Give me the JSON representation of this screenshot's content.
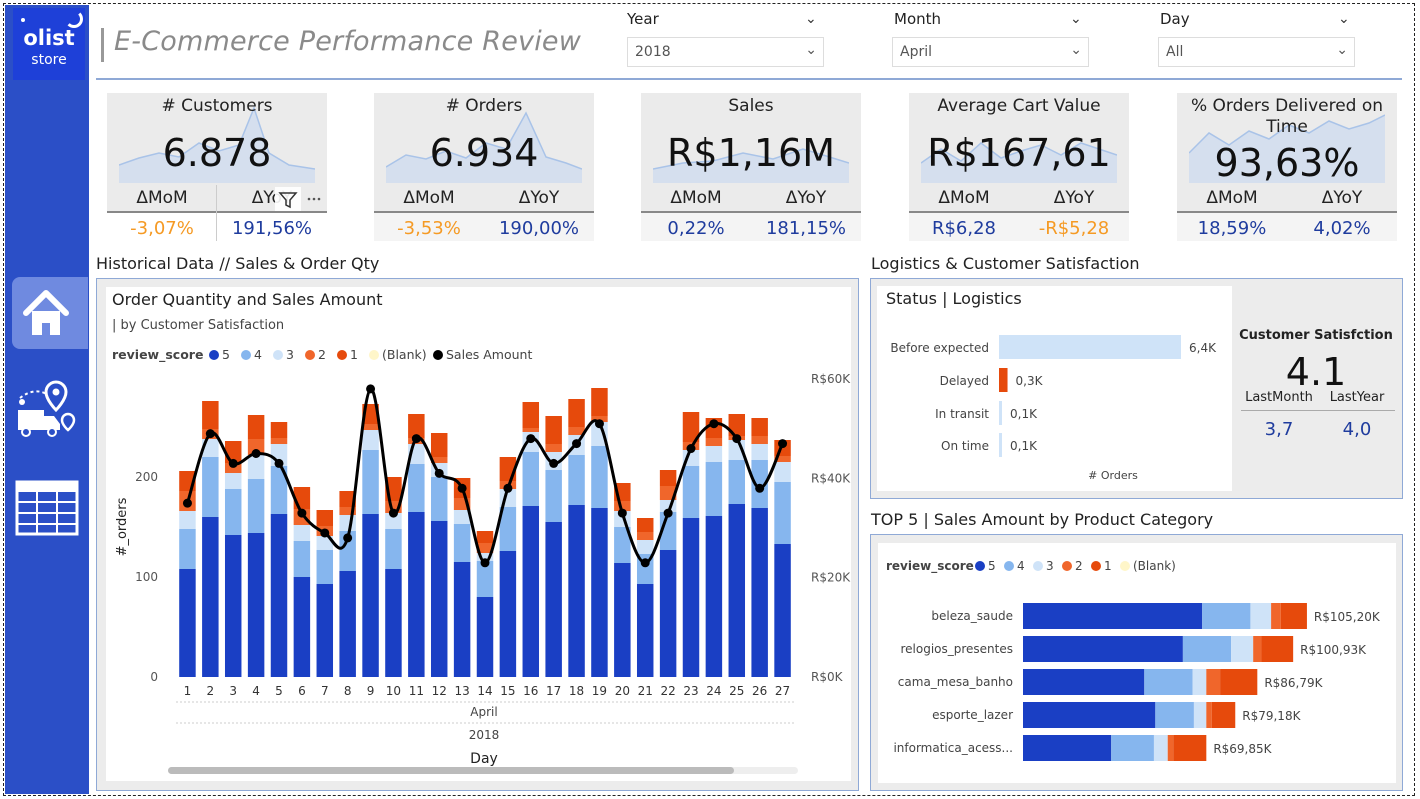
{
  "app": {
    "logo_line1": "olist",
    "logo_line2": "store",
    "title": "E-Commerce Performance Review"
  },
  "nav": [
    {
      "id": "home",
      "icon": "home-icon"
    },
    {
      "id": "logistics",
      "icon": "delivery-truck-icon"
    },
    {
      "id": "table",
      "icon": "table-grid-icon"
    }
  ],
  "filters": {
    "year": {
      "label": "Year",
      "value": "2018"
    },
    "month": {
      "label": "Month",
      "value": "April"
    },
    "day": {
      "label": "Day",
      "value": "All"
    }
  },
  "kpis": [
    {
      "title": "# Customers",
      "value": "6.878",
      "mom_label": "ΔMoM",
      "yoy_label": "ΔYoY",
      "mom": "-3,07%",
      "yoy": "191,56%",
      "mom_color": "#f59a24",
      "yoy_color": "#1f3c9e"
    },
    {
      "title": "# Orders",
      "value": "6.934",
      "mom_label": "ΔMoM",
      "yoy_label": "ΔYoY",
      "mom": "-3,53%",
      "yoy": "190,00%",
      "mom_color": "#f59a24",
      "yoy_color": "#1f3c9e"
    },
    {
      "title": "Sales",
      "value": "R$1,16M",
      "mom_label": "ΔMoM",
      "yoy_label": "ΔYoY",
      "mom": "0,22%",
      "yoy": "181,15%",
      "mom_color": "#1f3c9e",
      "yoy_color": "#1f3c9e"
    },
    {
      "title": "Average Cart Value",
      "value": "R$167,61",
      "mom_label": "ΔMoM",
      "yoy_label": "ΔYoY",
      "mom": "R$6,28",
      "yoy": "-R$5,28",
      "mom_color": "#1f3c9e",
      "yoy_color": "#f59a24"
    },
    {
      "title": "% Orders Delivered on Time",
      "value": "93,63%",
      "mom_label": "ΔMoM",
      "yoy_label": "ΔYoY",
      "mom": "18,59%",
      "yoy": "4,02%",
      "mom_color": "#1f3c9e",
      "yoy_color": "#1f3c9e"
    }
  ],
  "sections": {
    "historical": "Historical Data // Sales & Order Qty",
    "logistics": "Logistics & Customer Satisfaction",
    "top5": "TOP 5 | Sales Amount by Product Category"
  },
  "chart_data": [
    {
      "type": "bar",
      "title": "Order Quantity and Sales Amount",
      "subtitle": "| by Customer Satisfaction",
      "legend_title": "review_score",
      "legend_placement": "top-left",
      "stacked": true,
      "xlabel": "Day",
      "x_hierarchy": [
        "April",
        "2018"
      ],
      "ylabel": "#_orders",
      "y2label": "",
      "ylim": [
        0,
        300
      ],
      "y2lim": [
        0,
        60000
      ],
      "yticks": [
        "0",
        "100",
        "200"
      ],
      "y2ticks": [
        "R$0K",
        "R$20K",
        "R$40K",
        "R$60K"
      ],
      "categories": [
        "1",
        "2",
        "3",
        "4",
        "5",
        "6",
        "7",
        "8",
        "9",
        "10",
        "11",
        "12",
        "13",
        "14",
        "15",
        "16",
        "17",
        "18",
        "19",
        "20",
        "21",
        "22",
        "23",
        "24",
        "25",
        "26",
        "27"
      ],
      "series": [
        {
          "name": "5",
          "color": "#1a3fc4",
          "values": [
            108,
            160,
            142,
            144,
            163,
            100,
            93,
            106,
            163,
            108,
            165,
            156,
            115,
            80,
            126,
            171,
            155,
            172,
            169,
            114,
            93,
            127,
            159,
            161,
            173,
            169,
            133
          ]
        },
        {
          "name": "4",
          "color": "#86b6ee",
          "values": [
            40,
            60,
            46,
            54,
            48,
            36,
            34,
            40,
            64,
            40,
            48,
            44,
            38,
            36,
            44,
            54,
            52,
            50,
            62,
            36,
            30,
            38,
            52,
            54,
            44,
            48,
            62
          ]
        },
        {
          "name": "3",
          "color": "#cfe3f8",
          "values": [
            18,
            18,
            16,
            24,
            22,
            16,
            14,
            16,
            20,
            16,
            20,
            14,
            14,
            8,
            18,
            20,
            18,
            20,
            24,
            16,
            14,
            12,
            16,
            16,
            20,
            16,
            20
          ]
        },
        {
          "name": "2",
          "color": "#f0662b",
          "values": [
            20,
            10,
            10,
            16,
            6,
            16,
            10,
            8,
            6,
            12,
            6,
            6,
            12,
            10,
            8,
            4,
            8,
            8,
            6,
            10,
            8,
            14,
            8,
            8,
            4,
            8,
            6
          ]
        },
        {
          "name": "1",
          "color": "#e64a0c",
          "values": [
            20,
            28,
            22,
            24,
            16,
            22,
            16,
            16,
            20,
            24,
            24,
            24,
            20,
            12,
            24,
            26,
            28,
            28,
            28,
            18,
            14,
            16,
            30,
            20,
            22,
            18,
            16
          ]
        },
        {
          "name": "(Blank)",
          "color": "#fff6c9",
          "values": [
            0,
            0,
            0,
            0,
            0,
            0,
            0,
            0,
            0,
            0,
            0,
            0,
            0,
            0,
            0,
            0,
            0,
            0,
            0,
            0,
            0,
            0,
            0,
            0,
            0,
            0,
            0
          ]
        }
      ],
      "line_series": {
        "name": "Sales Amount",
        "color": "#000000",
        "axis": "y2",
        "values": [
          35000,
          49000,
          43000,
          45000,
          43000,
          33000,
          29000,
          28000,
          58000,
          33000,
          48000,
          41000,
          38000,
          23000,
          38000,
          48000,
          43000,
          47000,
          51000,
          33000,
          23000,
          33000,
          46000,
          51000,
          48000,
          38000,
          47000
        ]
      }
    },
    {
      "type": "bar",
      "orientation": "horizontal",
      "title": "Status | Logistics",
      "xlabel": "# Orders",
      "categories": [
        "Before expected",
        "Delayed",
        "In transit",
        "On time"
      ],
      "values": [
        6400,
        300,
        100,
        100
      ],
      "value_labels": [
        "6,4K",
        "0,3K",
        "0,1K",
        "0,1K"
      ],
      "colors": [
        "#cfe3f8",
        "#e64a0c",
        "#cfe3f8",
        "#cfe3f8"
      ]
    },
    {
      "type": "bar",
      "orientation": "horizontal",
      "stacked": true,
      "title": "",
      "legend_title": "review_score",
      "legend_placement": "top-left",
      "categories": [
        "beleza_saude",
        "relogios_presentes",
        "cama_mesa_banho",
        "esporte_lazer",
        "informatica_acess..."
      ],
      "totals": [
        105200,
        100930,
        86790,
        79180,
        69850
      ],
      "total_labels": [
        "R$105,20K",
        "R$100,93K",
        "R$86,79K",
        "R$79,18K",
        "R$69,85K"
      ],
      "series": [
        {
          "name": "5",
          "color": "#1a3fc4",
          "values": [
            65000,
            58000,
            44000,
            48000,
            32000
          ]
        },
        {
          "name": "4",
          "color": "#86b6ee",
          "values": [
            17500,
            17500,
            17500,
            14000,
            15500
          ]
        },
        {
          "name": "3",
          "color": "#cfe3f8",
          "values": [
            7500,
            8000,
            5000,
            4500,
            5000
          ]
        },
        {
          "name": "2",
          "color": "#f0662b",
          "values": [
            3500,
            3000,
            5000,
            2000,
            2000
          ]
        },
        {
          "name": "1",
          "color": "#e64a0c",
          "values": [
            9500,
            11500,
            13500,
            8500,
            12000
          ]
        },
        {
          "name": "(Blank)",
          "color": "#fff6c9",
          "values": [
            0,
            0,
            0,
            0,
            0
          ]
        }
      ]
    }
  ],
  "satisfaction": {
    "title": "Customer Satisfction",
    "value": "4.1",
    "last_month_label": "LastMonth",
    "last_year_label": "LastYear",
    "last_month": "3,7",
    "last_year": "4,0"
  },
  "legend_title": "review_score",
  "colors": {
    "accent": "#2b4fc7",
    "negative": "#f59a24",
    "positive": "#1f3c9e"
  }
}
